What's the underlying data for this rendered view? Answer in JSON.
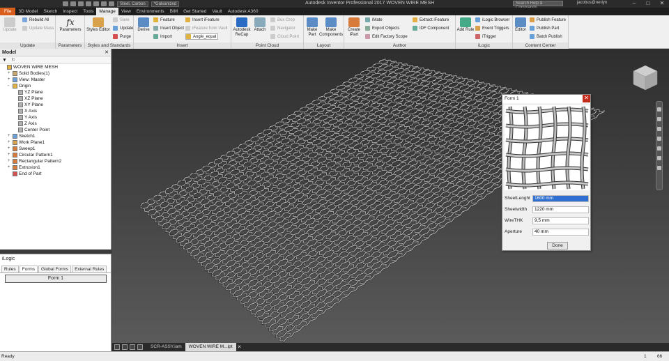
{
  "titlebar": {
    "file_label": "File",
    "material_select": "Steel, Carbon",
    "appearance_select": "*Galvanized",
    "app_title": "Autodesk Inventor Professional 2017    WOVEN WIRE MESH",
    "help_placeholder": "Search Help & Commands...",
    "user": "jacobus@renlyn",
    "minimize": "–",
    "maximize": "□",
    "close": "✕"
  },
  "menu_tabs": [
    "3D Model",
    "Sketch",
    "Inspect",
    "Tools",
    "Manage",
    "View",
    "Environments",
    "BIM",
    "Get Started",
    "Vault",
    "Autodesk A360"
  ],
  "ribbon": {
    "update": {
      "label": "Update",
      "big": "Update",
      "small": [
        "Rebuild All",
        "Update Mass"
      ]
    },
    "parameters": {
      "label": "Parameters",
      "big": "Parameters"
    },
    "styles": {
      "label": "Styles and Standards",
      "big": "Styles Editor",
      "small": [
        "Save",
        "Update",
        "Purge"
      ]
    },
    "insert": {
      "label": "Insert",
      "big": "Derive",
      "small": [
        "Feature",
        "Insert Object",
        "Import"
      ],
      "small2": [
        "Insert iFeature",
        "iFeature from Vault",
        "Angle_equal"
      ]
    },
    "pointcloud": {
      "label": "Point Cloud",
      "big1": "Autodesk ReCap",
      "big2": "Attach",
      "small": [
        "Box Crop",
        "Navigator",
        "Cloud Point"
      ]
    },
    "layout": {
      "label": "Layout",
      "big1": "Make Part",
      "big2": "Make Components"
    },
    "author": {
      "label": "Author",
      "big": "Create iPart",
      "small": [
        "iMate",
        "Export Objects",
        "Edit Factory Scope"
      ],
      "small2": [
        "Extract iFeature",
        "IDF Component"
      ]
    },
    "ilogic": {
      "label": "iLogic",
      "big": "Add Rule",
      "small": [
        "iLogic Browser",
        "Event Triggers",
        "iTrigger"
      ]
    },
    "content": {
      "label": "Content Center",
      "big": "Editor",
      "small": [
        "Publish Feature",
        "Publish Part",
        "Batch Publish"
      ]
    }
  },
  "browser": {
    "title": "Model",
    "tree": [
      {
        "label": "WOVEN WIRE MESH",
        "indent": 0,
        "expander": ""
      },
      {
        "label": "Solid Bodies(1)",
        "indent": 1,
        "expander": "+"
      },
      {
        "label": "View: Master",
        "indent": 1,
        "expander": "+"
      },
      {
        "label": "Origin",
        "indent": 1,
        "expander": "-"
      },
      {
        "label": "YZ Plane",
        "indent": 2,
        "expander": ""
      },
      {
        "label": "XZ Plane",
        "indent": 2,
        "expander": ""
      },
      {
        "label": "XY Plane",
        "indent": 2,
        "expander": ""
      },
      {
        "label": "X Axis",
        "indent": 2,
        "expander": ""
      },
      {
        "label": "Y Axis",
        "indent": 2,
        "expander": ""
      },
      {
        "label": "Z Axis",
        "indent": 2,
        "expander": ""
      },
      {
        "label": "Center Point",
        "indent": 2,
        "expander": ""
      },
      {
        "label": "Sketch1",
        "indent": 1,
        "expander": "+"
      },
      {
        "label": "Work Plane1",
        "indent": 1,
        "expander": "+"
      },
      {
        "label": "Sweep1",
        "indent": 1,
        "expander": "+"
      },
      {
        "label": "Circular Pattern1",
        "indent": 1,
        "expander": "+"
      },
      {
        "label": "Rectangular Pattern2",
        "indent": 1,
        "expander": "+"
      },
      {
        "label": "Extrusion1",
        "indent": 1,
        "expander": "+"
      },
      {
        "label": "End of Part",
        "indent": 1,
        "expander": ""
      }
    ]
  },
  "ilogic": {
    "title": "iLogic",
    "tabs": [
      "Rules",
      "Forms",
      "Global Forms",
      "External Rules"
    ],
    "active_tab": "Forms",
    "form_button": "Form 1"
  },
  "doc_tabs": [
    "SCR-ASSY.iam",
    "WOVEN WIRE M...ipt"
  ],
  "status": {
    "text": "Ready",
    "page": "1",
    "count": "66"
  },
  "form": {
    "title": "Form 1",
    "fields": [
      {
        "label": "SheetLenght",
        "value": "1600 mm"
      },
      {
        "label": "Sheetwidth",
        "value": "1220 mm"
      },
      {
        "label": "WireTHK",
        "value": "9,5 mm"
      },
      {
        "label": "Aperture",
        "value": "40 mm"
      }
    ],
    "done": "Done"
  },
  "colors": {
    "file_tab": "#d95d1b",
    "selection": "#2f6fd1",
    "close": "#c42b1c"
  }
}
